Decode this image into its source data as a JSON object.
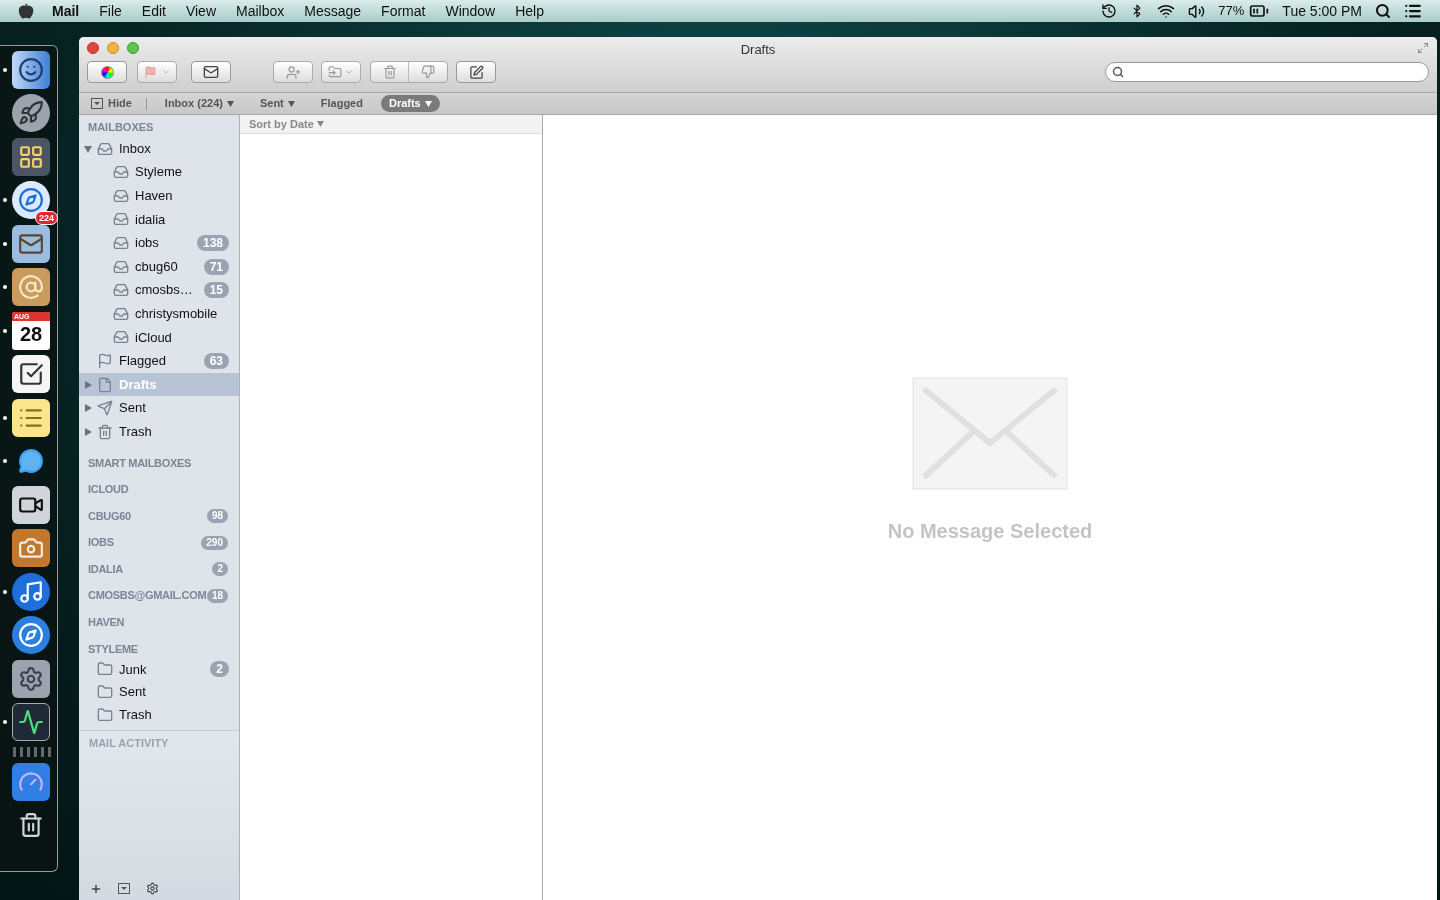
{
  "menubar": {
    "app": "Mail",
    "menus": [
      "File",
      "Edit",
      "View",
      "Mailbox",
      "Message",
      "Format",
      "Window",
      "Help"
    ],
    "battery": "77%",
    "clock": "Tue 5:00 PM"
  },
  "dock": [
    {
      "kind": "finder",
      "running": true
    },
    {
      "kind": "launchpad",
      "running": false
    },
    {
      "kind": "mission",
      "running": false
    },
    {
      "kind": "safari",
      "running": true
    },
    {
      "kind": "mail",
      "running": true,
      "badge": "224"
    },
    {
      "kind": "contacts",
      "running": true
    },
    {
      "kind": "calendar",
      "running": true,
      "month": "AUG",
      "day": "28"
    },
    {
      "kind": "reminders",
      "running": false
    },
    {
      "kind": "notes",
      "running": true
    },
    {
      "kind": "messages",
      "running": true
    },
    {
      "kind": "facetime",
      "running": false
    },
    {
      "kind": "photos",
      "running": false
    },
    {
      "kind": "music",
      "running": true
    },
    {
      "kind": "appstore",
      "running": false
    },
    {
      "kind": "settings",
      "running": false
    },
    {
      "kind": "activity",
      "running": true
    },
    {
      "kind": "separator",
      "running": false
    },
    {
      "kind": "dashboard",
      "running": false
    },
    {
      "kind": "trash",
      "running": false
    }
  ],
  "window": {
    "title": "Drafts"
  },
  "favorites_bar": {
    "hide": "Hide",
    "items": [
      {
        "label": "Inbox (224)",
        "menu": true,
        "selected": false
      },
      {
        "label": "Sent",
        "menu": true,
        "selected": false
      },
      {
        "label": "Flagged",
        "menu": false,
        "selected": false
      },
      {
        "label": "Drafts",
        "menu": true,
        "selected": true
      }
    ]
  },
  "sidebar": {
    "mailboxes_header": "MAILBOXES",
    "mailboxes": [
      {
        "kind": "inbox",
        "label": "Inbox",
        "expanded": true,
        "selected": false,
        "children": [
          {
            "kind": "inbox",
            "label": "Styleme",
            "selected": false
          },
          {
            "kind": "inbox",
            "label": "Haven",
            "selected": false
          },
          {
            "kind": "inbox",
            "label": "idalia",
            "selected": false
          },
          {
            "kind": "inbox",
            "label": "iobs",
            "badge": "138",
            "selected": false
          },
          {
            "kind": "inbox",
            "label": "cbug60",
            "badge": "71",
            "selected": false
          },
          {
            "kind": "inbox",
            "label": "cmosbs…",
            "badge": "15",
            "selected": false
          },
          {
            "kind": "inbox",
            "label": "christysmobile",
            "selected": false
          },
          {
            "kind": "inbox",
            "label": "iCloud",
            "selected": false
          }
        ]
      },
      {
        "kind": "flagged",
        "label": "Flagged",
        "badge": "63",
        "selected": false
      },
      {
        "kind": "drafts",
        "label": "Drafts",
        "expanded": false,
        "selected": true
      },
      {
        "kind": "sent",
        "label": "Sent",
        "expanded": false,
        "selected": false
      },
      {
        "kind": "trash",
        "label": "Trash",
        "expanded": false,
        "selected": false
      }
    ],
    "sections": [
      {
        "label": "SMART MAILBOXES"
      },
      {
        "label": "ICLOUD"
      },
      {
        "label": "CBUG60",
        "badge": "98"
      },
      {
        "label": "IOBS",
        "badge": "290"
      },
      {
        "label": "IDALIA",
        "badge": "2"
      },
      {
        "label": "CMOSBS@GMAIL.COM",
        "badge": "18"
      },
      {
        "label": "HAVEN"
      },
      {
        "label": "STYLEME",
        "folders": [
          {
            "label": "Junk",
            "badge": "2"
          },
          {
            "label": "Sent"
          },
          {
            "label": "Trash"
          }
        ]
      }
    ],
    "activity_header": "MAIL ACTIVITY"
  },
  "message_list": {
    "sort": "Sort by Date"
  },
  "viewer": {
    "empty_text": "No Message Selected"
  }
}
